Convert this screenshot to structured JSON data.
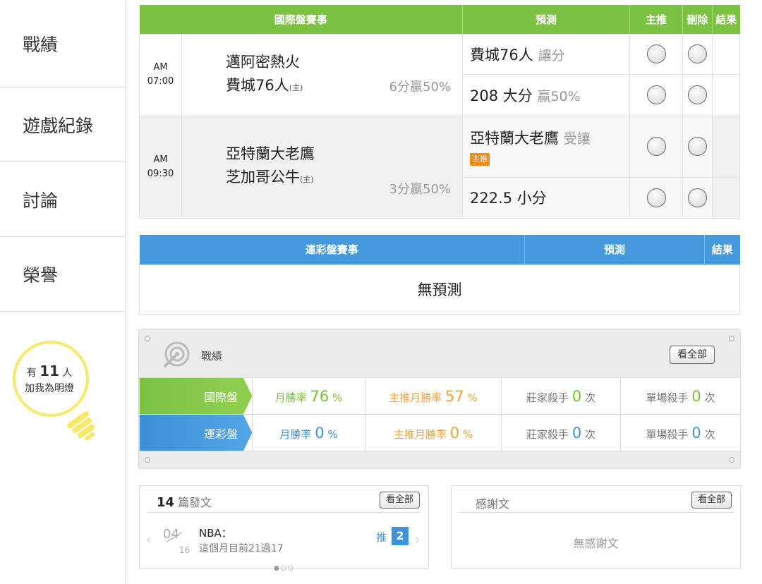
{
  "sidebar": {
    "items": [
      {
        "label": "戰績"
      },
      {
        "label": "遊戲紀錄"
      },
      {
        "label": "討論"
      },
      {
        "label": "榮譽"
      }
    ],
    "lamp": {
      "prefix": "有",
      "count": "11",
      "suffix": "人",
      "text": "加我為明燈"
    }
  },
  "intl": {
    "headers": {
      "event": "國際盤賽事",
      "predict": "預測",
      "main": "主推",
      "delete": "刪除",
      "result": "結果"
    },
    "games": [
      {
        "ampm": "AM",
        "time": "07:00",
        "away": "邁阿密熱火",
        "home": "費城76人",
        "home_mark": "(主)",
        "odds": "6分贏50%",
        "predictions": [
          {
            "team": "費城76人",
            "type": "讓分",
            "badge": ""
          },
          {
            "team": "208 大分",
            "type": "贏50%",
            "badge": ""
          }
        ]
      },
      {
        "ampm": "AM",
        "time": "09:30",
        "away": "亞特蘭大老鷹",
        "home": "芝加哥公牛",
        "home_mark": "(主)",
        "odds": "3分贏50%",
        "predictions": [
          {
            "team": "亞特蘭大老鷹",
            "type": "受讓",
            "badge": "主推"
          },
          {
            "team": "222.5 小分",
            "type": "",
            "badge": ""
          }
        ]
      }
    ]
  },
  "sports": {
    "headers": {
      "event": "運彩盤賽事",
      "predict": "預測",
      "result": "結果"
    },
    "empty": "無預測"
  },
  "record": {
    "title": "戰績",
    "view_all": "看全部",
    "rows": [
      {
        "label": "國際盤",
        "month_label": "月勝率",
        "month_value": "76",
        "main_label": "主推月勝率",
        "main_value": "57",
        "pct": "%",
        "banker_label": "莊家殺手",
        "banker_value": "0",
        "single_label": "單場殺手",
        "single_value": "0",
        "times": "次"
      },
      {
        "label": "運彩盤",
        "month_label": "月勝率",
        "month_value": "0",
        "main_label": "主推月勝率",
        "main_value": "0",
        "pct": "%",
        "banker_label": "莊家殺手",
        "banker_value": "0",
        "single_label": "單場殺手",
        "single_value": "0",
        "times": "次"
      }
    ]
  },
  "posts": {
    "count": "14",
    "count_label": "篇發文",
    "view_all": "看全部",
    "item": {
      "day": "04",
      "month": "16",
      "title": "NBA：",
      "subtitle": "這個月目前21過17",
      "push_label": "推",
      "push_value": "2"
    }
  },
  "thanks": {
    "title": "感謝文",
    "view_all": "看全部",
    "empty": "無感謝文"
  },
  "colors": {
    "green": "#7cc242",
    "blue": "#4499dd",
    "orange": "#f0a23a"
  }
}
